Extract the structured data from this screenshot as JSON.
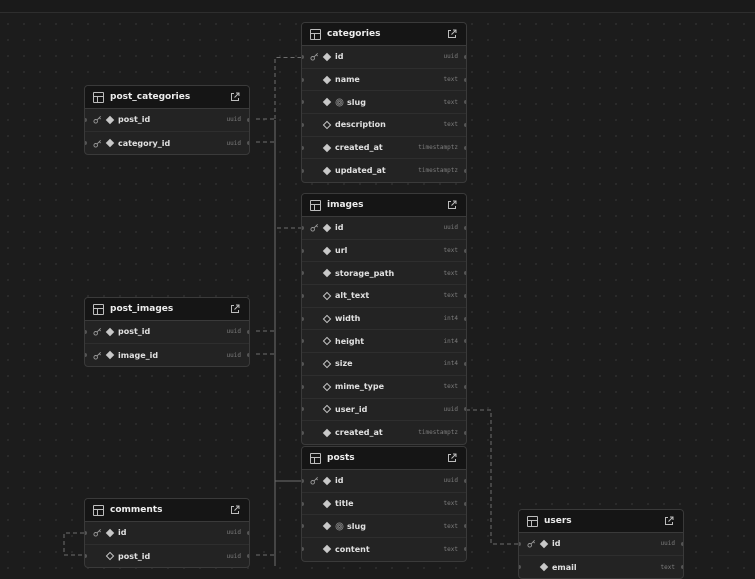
{
  "tables": [
    {
      "name": "categories",
      "columns": [
        {
          "name": "id",
          "type": "uuid",
          "primary": true,
          "required": true,
          "unique": false
        },
        {
          "name": "name",
          "type": "text",
          "primary": false,
          "required": true,
          "unique": false
        },
        {
          "name": "slug",
          "type": "text",
          "primary": false,
          "required": true,
          "unique": true
        },
        {
          "name": "description",
          "type": "text",
          "primary": false,
          "required": false,
          "unique": false
        },
        {
          "name": "created_at",
          "type": "timestamptz",
          "primary": false,
          "required": true,
          "unique": false
        },
        {
          "name": "updated_at",
          "type": "timestamptz",
          "primary": false,
          "required": true,
          "unique": false
        }
      ]
    },
    {
      "name": "post_categories",
      "columns": [
        {
          "name": "post_id",
          "type": "uuid",
          "primary": true,
          "required": true,
          "unique": false
        },
        {
          "name": "category_id",
          "type": "uuid",
          "primary": true,
          "required": true,
          "unique": false
        }
      ]
    },
    {
      "name": "images",
      "columns": [
        {
          "name": "id",
          "type": "uuid",
          "primary": true,
          "required": true,
          "unique": false
        },
        {
          "name": "url",
          "type": "text",
          "primary": false,
          "required": true,
          "unique": false
        },
        {
          "name": "storage_path",
          "type": "text",
          "primary": false,
          "required": true,
          "unique": false
        },
        {
          "name": "alt_text",
          "type": "text",
          "primary": false,
          "required": false,
          "unique": false
        },
        {
          "name": "width",
          "type": "int4",
          "primary": false,
          "required": false,
          "unique": false
        },
        {
          "name": "height",
          "type": "int4",
          "primary": false,
          "required": false,
          "unique": false
        },
        {
          "name": "size",
          "type": "int4",
          "primary": false,
          "required": false,
          "unique": false
        },
        {
          "name": "mime_type",
          "type": "text",
          "primary": false,
          "required": false,
          "unique": false
        },
        {
          "name": "user_id",
          "type": "uuid",
          "primary": false,
          "required": false,
          "unique": false
        },
        {
          "name": "created_at",
          "type": "timestamptz",
          "primary": false,
          "required": true,
          "unique": false
        }
      ]
    },
    {
      "name": "post_images",
      "columns": [
        {
          "name": "post_id",
          "type": "uuid",
          "primary": true,
          "required": true,
          "unique": false
        },
        {
          "name": "image_id",
          "type": "uuid",
          "primary": true,
          "required": true,
          "unique": false
        }
      ]
    },
    {
      "name": "posts",
      "columns": [
        {
          "name": "id",
          "type": "uuid",
          "primary": true,
          "required": true,
          "unique": false
        },
        {
          "name": "title",
          "type": "text",
          "primary": false,
          "required": true,
          "unique": false
        },
        {
          "name": "slug",
          "type": "text",
          "primary": false,
          "required": true,
          "unique": true
        },
        {
          "name": "content",
          "type": "text",
          "primary": false,
          "required": true,
          "unique": false
        }
      ]
    },
    {
      "name": "comments",
      "columns": [
        {
          "name": "id",
          "type": "uuid",
          "primary": true,
          "required": true,
          "unique": false
        },
        {
          "name": "post_id",
          "type": "uuid",
          "primary": false,
          "required": false,
          "unique": false
        }
      ]
    },
    {
      "name": "users",
      "columns": [
        {
          "name": "id",
          "type": "uuid",
          "primary": true,
          "required": true,
          "unique": false
        },
        {
          "name": "email",
          "type": "text",
          "primary": false,
          "required": true,
          "unique": false
        }
      ]
    }
  ],
  "colors": {
    "canvas": "#1c1c1c",
    "table_bg": "#232323",
    "header_bg": "#151515",
    "border": "#3a3a3a",
    "connector": "#6e6e6e"
  }
}
